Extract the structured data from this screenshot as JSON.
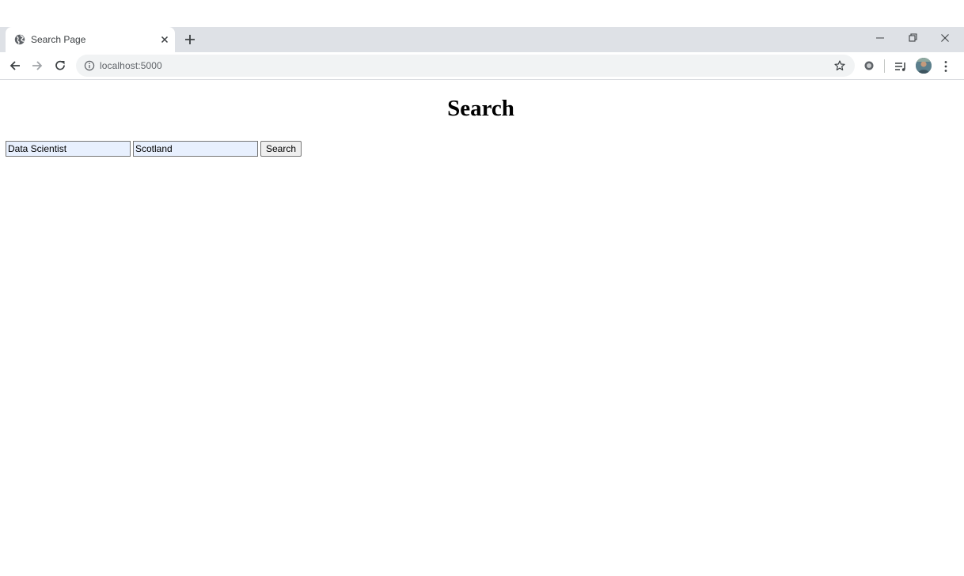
{
  "browser": {
    "tab": {
      "title": "Search Page",
      "favicon": "globe-icon",
      "close_icon": "close-icon"
    },
    "new_tab_icon": "plus-icon",
    "window_controls": [
      "minimize-icon",
      "restore-icon",
      "close-icon"
    ],
    "toolbar": {
      "back_icon": "arrow-left-icon",
      "forward_icon": "arrow-right-icon",
      "reload_icon": "reload-icon",
      "site_info_icon": "info-icon",
      "url": "localhost:5000",
      "bookmark_icon": "star-icon",
      "extension_icon": "extension-icon",
      "media_icon": "media-control-icon",
      "profile_icon": "avatar",
      "menu_icon": "more-vertical-icon"
    },
    "colors": {
      "tabstrip": "#dee1e6",
      "omnibox": "#f1f3f4",
      "autofill": "#e8f0fe"
    }
  },
  "page": {
    "title": "Search",
    "form": {
      "job_value": "Data Scientist",
      "location_value": "Scotland",
      "button_label": "Search"
    }
  }
}
